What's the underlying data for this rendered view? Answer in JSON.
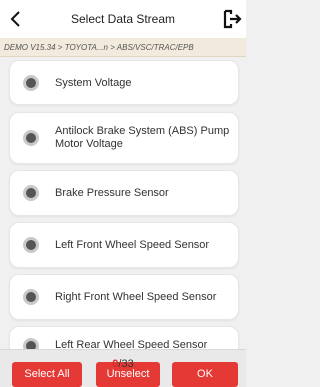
{
  "header": {
    "title": "Select Data Stream"
  },
  "breadcrumb": "DEMO V15.34 > TOYOTA...n > ABS/VSC/TRAC/EPB",
  "items": [
    {
      "label": "System Voltage"
    },
    {
      "label": "Antilock Brake System (ABS) Pump Motor Voltage"
    },
    {
      "label": "Brake Pressure Sensor"
    },
    {
      "label": "Left Front Wheel Speed Sensor"
    },
    {
      "label": "Right Front Wheel Speed Sensor"
    },
    {
      "label": "Left Rear Wheel Speed Sensor"
    }
  ],
  "counter": {
    "selected": "0",
    "separator": "/",
    "total": "33"
  },
  "footer": {
    "select_all": "Select All",
    "unselect": "Unselect",
    "ok": "OK"
  },
  "colors": {
    "accent": "#e53935",
    "breadcrumb_bg": "#f2eadc"
  }
}
